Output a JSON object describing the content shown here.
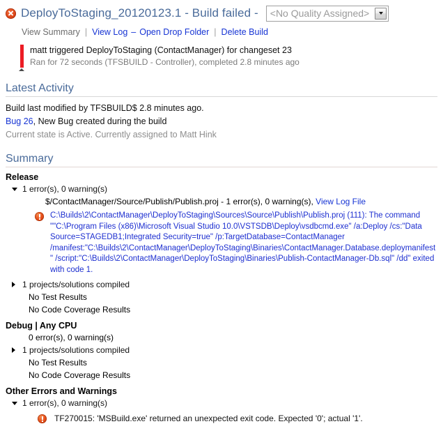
{
  "header": {
    "status_icon": "error-circle-x-icon",
    "title": "DeployToStaging_20120123.1 - Build failed - ",
    "quality": {
      "value": "<No Quality Assigned>",
      "arrow_icon": "chevron-down-icon"
    },
    "links": {
      "view_summary": "View Summary",
      "sep1": "|",
      "view_log": "View Log",
      "sep2": "–",
      "open_drop_folder": "Open Drop Folder",
      "sep3": "|",
      "delete_build": "Delete Build"
    },
    "trigger": {
      "line1": "matt triggered DeployToStaging (ContactManager) for changeset 23",
      "line2": "Ran for 72 seconds (TFSBUILD - Controller), completed 2.8 minutes ago"
    }
  },
  "latest_activity": {
    "heading": "Latest Activity",
    "modified": "Build last modified by TFSBUILD$ 2.8 minutes ago.",
    "bug_link": "Bug 26",
    "bug_rest": ", New Bug created during the build",
    "bug_state": "Current state is Active. Currently assigned to Matt Hink"
  },
  "summary": {
    "heading": "Summary",
    "sections": [
      {
        "name": "Release",
        "counts": "1 error(s), 0 warning(s)",
        "counts_expanded": true,
        "project_line_text": "$/ContactManager/Source/Publish/Publish.proj - 1 error(s), 0 warning(s), ",
        "project_log_link": "View Log File",
        "error_icon": "error-circle-exclamation-icon",
        "error_text": "C:\\Builds\\2\\ContactManager\\DeployToStaging\\Sources\\Source\\Publish\\Publish.proj (111): The command \"\"C:\\Program Files (x86)\\Microsoft Visual Studio 10.0\\VSTSDB\\Deploy\\vsdbcmd.exe\" /a:Deploy /cs:\"Data Source=STAGEDB1;Integrated Security=true\" /p:TargetDatabase=ContactManager /manifest:\"C:\\Builds\\2\\ContactManager\\DeployToStaging\\Binaries\\ContactManager.Database.deploymanifest\" /script:\"C:\\Builds\\2\\ContactManager\\DeployToStaging\\Binaries\\Publish-ContactManager-Db.sql\" /dd\" exited with code 1.",
        "compiled": "1 projects/solutions compiled",
        "no_test": "No Test Results",
        "no_coverage": "No Code Coverage Results"
      },
      {
        "name": "Debug | Any CPU",
        "counts": "0 error(s), 0 warning(s)",
        "counts_expanded": false,
        "compiled": "1 projects/solutions compiled",
        "no_test": "No Test Results",
        "no_coverage": "No Code Coverage Results"
      }
    ],
    "other": {
      "name": "Other Errors and Warnings",
      "counts": "1 error(s), 0 warning(s)",
      "error_icon": "error-circle-exclamation-icon",
      "error_text": "TF270015: 'MSBuild.exe' returned an unexpected exit code. Expected '0'; actual '1'."
    }
  }
}
